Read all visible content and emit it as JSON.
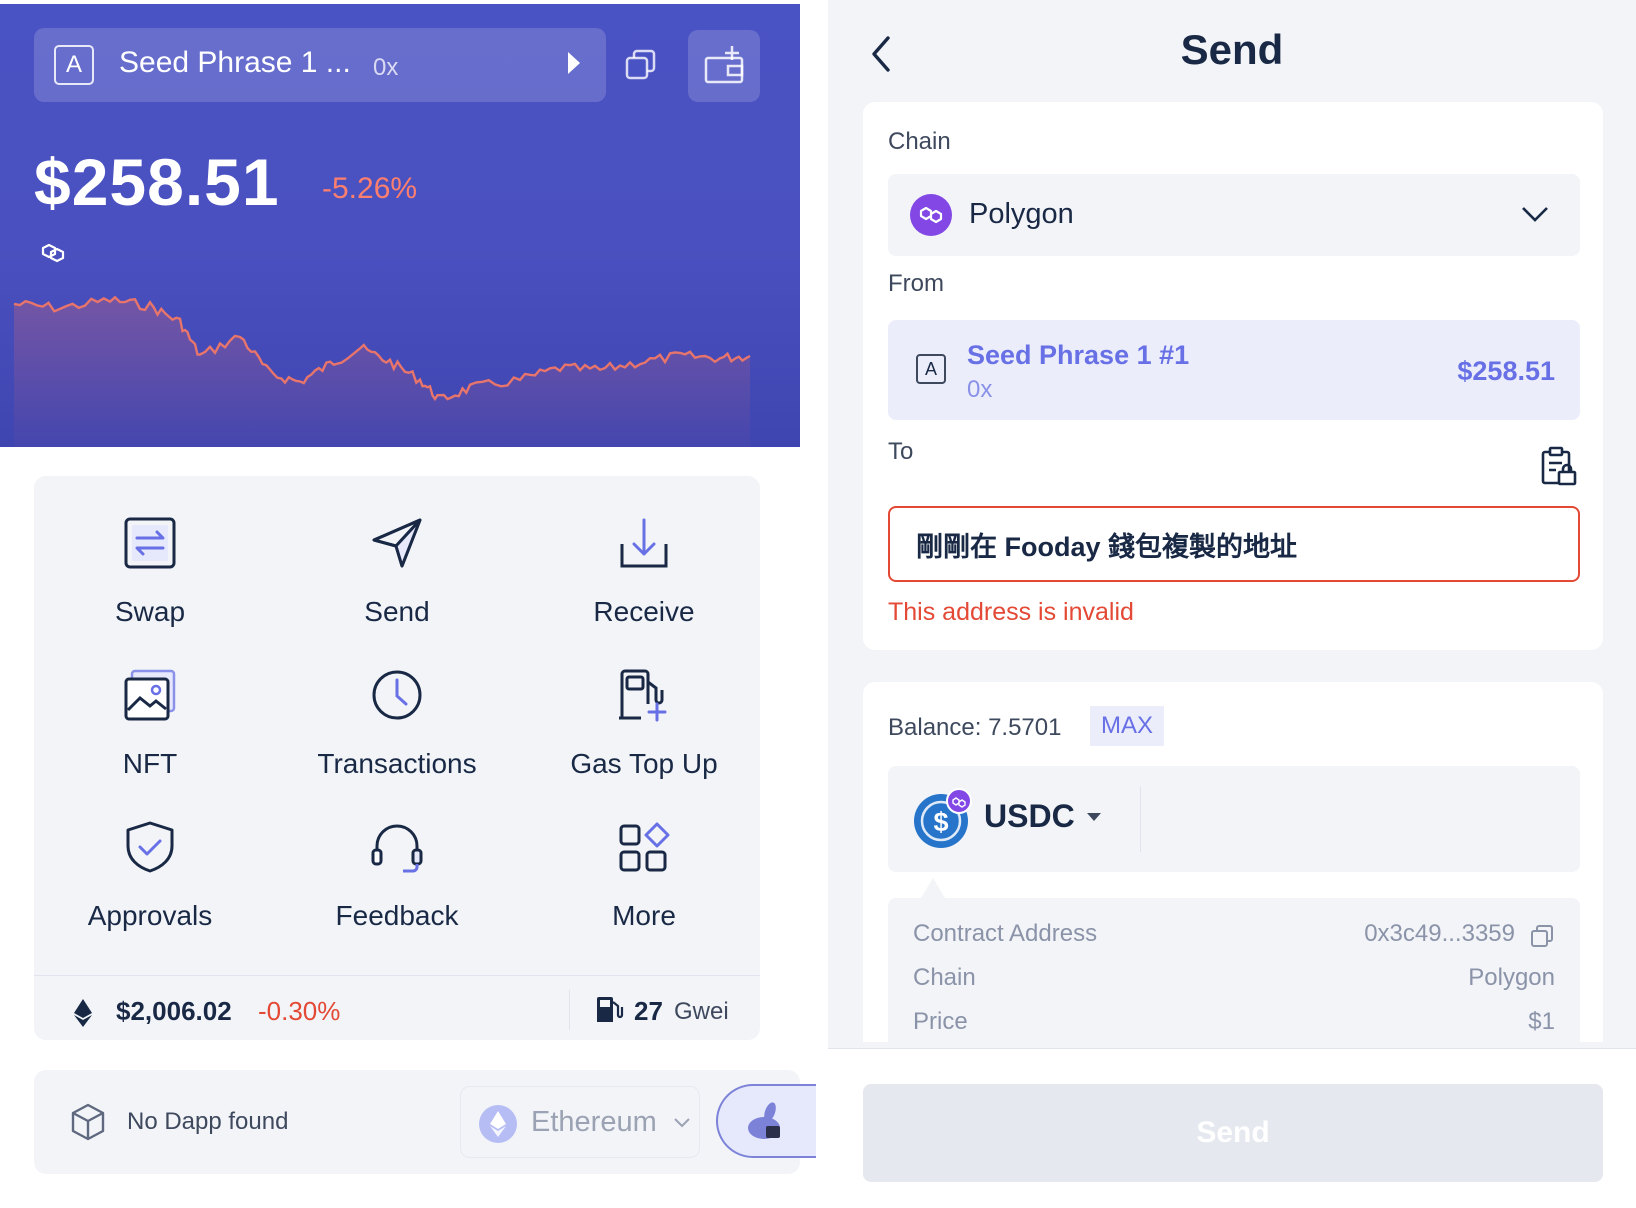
{
  "left": {
    "account": {
      "letter": "A",
      "name": "Seed Phrase 1 ...",
      "address": "0x"
    },
    "balance": "$258.51",
    "change": "-5.26%",
    "actions": [
      {
        "label": "Swap",
        "icon": "swap-icon"
      },
      {
        "label": "Send",
        "icon": "send-icon"
      },
      {
        "label": "Receive",
        "icon": "receive-icon"
      },
      {
        "label": "NFT",
        "icon": "nft-icon"
      },
      {
        "label": "Transactions",
        "icon": "clock-icon"
      },
      {
        "label": "Gas Top Up",
        "icon": "gas-top-up-icon"
      },
      {
        "label": "Approvals",
        "icon": "shield-icon"
      },
      {
        "label": "Feedback",
        "icon": "headset-icon"
      },
      {
        "label": "More",
        "icon": "grid-icon"
      }
    ],
    "stats": {
      "eth_price": "$2,006.02",
      "eth_change": "-0.30%",
      "gas": "27",
      "gas_unit": "Gwei"
    },
    "dapp": {
      "empty_text": "No Dapp found",
      "chain": "Ethereum"
    }
  },
  "right": {
    "title": "Send",
    "chain_label": "Chain",
    "chain_value": "Polygon",
    "from_label": "From",
    "from": {
      "letter": "A",
      "name": "Seed Phrase 1 #1",
      "address": "0x",
      "balance": "$258.51"
    },
    "to_label": "To",
    "to_value": "剛剛在 Fooday 錢包複製的地址",
    "error": "This address is invalid",
    "balance_label": "Balance: 7.5701",
    "max_label": "MAX",
    "token": "USDC",
    "details": [
      {
        "key": "Contract Address",
        "value": "0x3c49...3359"
      },
      {
        "key": "Chain",
        "value": "Polygon"
      },
      {
        "key": "Price",
        "value": "$1"
      }
    ],
    "send_button": "Send"
  },
  "colors": {
    "hero": "#4a53c4",
    "accent": "#6870e6",
    "error": "#e34935",
    "polygon": "#8247e5",
    "usdc": "#2775ca"
  }
}
